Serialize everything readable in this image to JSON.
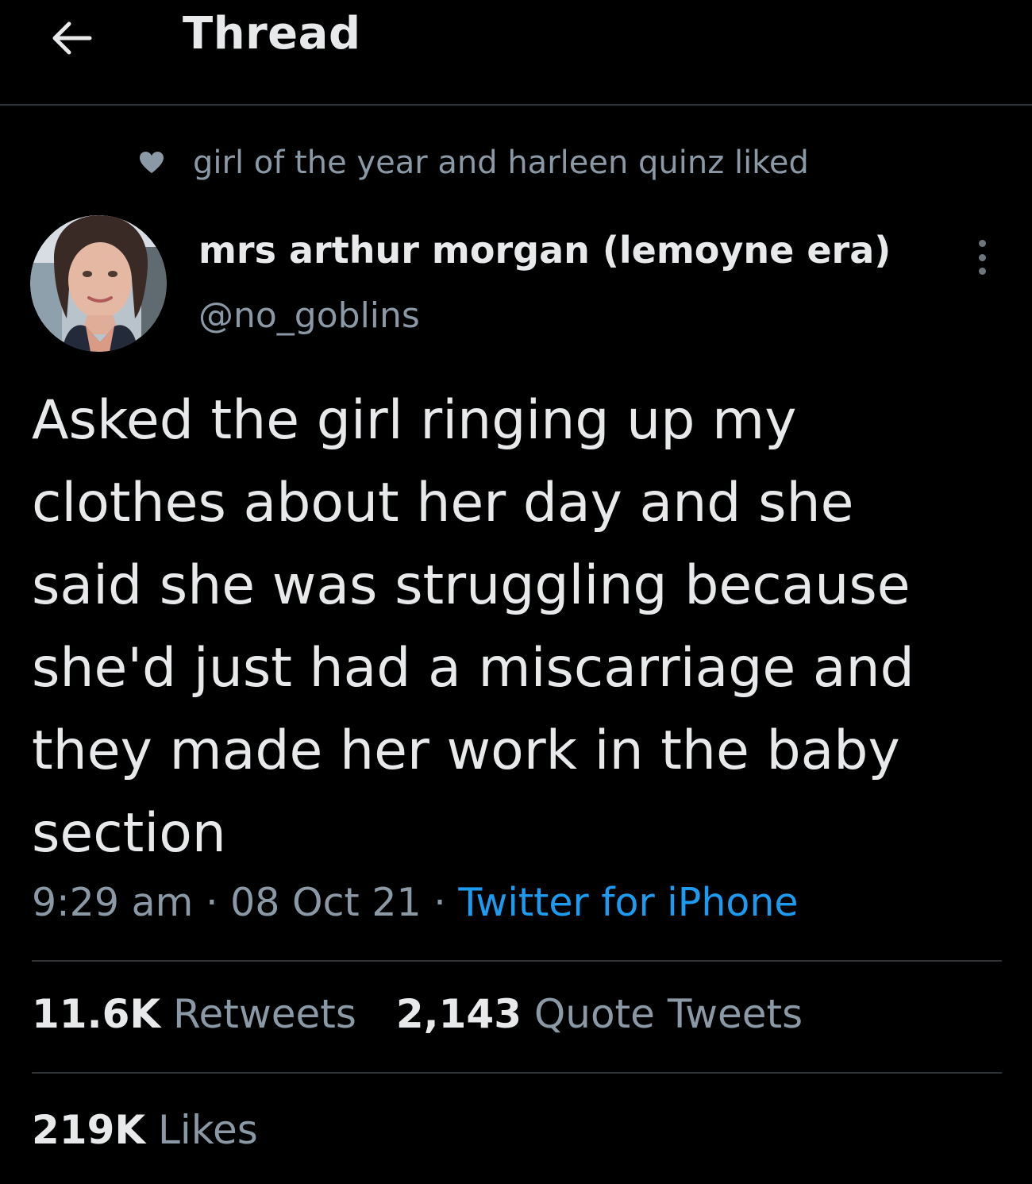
{
  "header": {
    "title": "Thread",
    "back_icon": "arrow-left-icon"
  },
  "social_context": {
    "icon": "heart-icon",
    "text": "girl of the year and harleen quinz liked"
  },
  "author": {
    "display_name": "mrs arthur morgan (lemoyne era)",
    "handle": "@no_goblins"
  },
  "tweet": {
    "text": "Asked the girl ringing up my\nclothes about her day and she\nsaid she was struggling because\nshe'd just had a miscarriage and\nthey made her work in the baby\nsection",
    "time": "9:29 am",
    "date": "08 Oct 21",
    "separator": "·",
    "source": "Twitter for iPhone"
  },
  "stats": {
    "retweets_count": "11.6K",
    "retweets_label": "Retweets",
    "quotes_count": "2,143",
    "quotes_label": "Quote Tweets",
    "likes_count": "219K",
    "likes_label": "Likes"
  },
  "colors": {
    "background": "#000000",
    "text": "#e7e9ea",
    "secondary": "#8b98a5",
    "link": "#1d9bf0",
    "divider": "#2f3336"
  }
}
